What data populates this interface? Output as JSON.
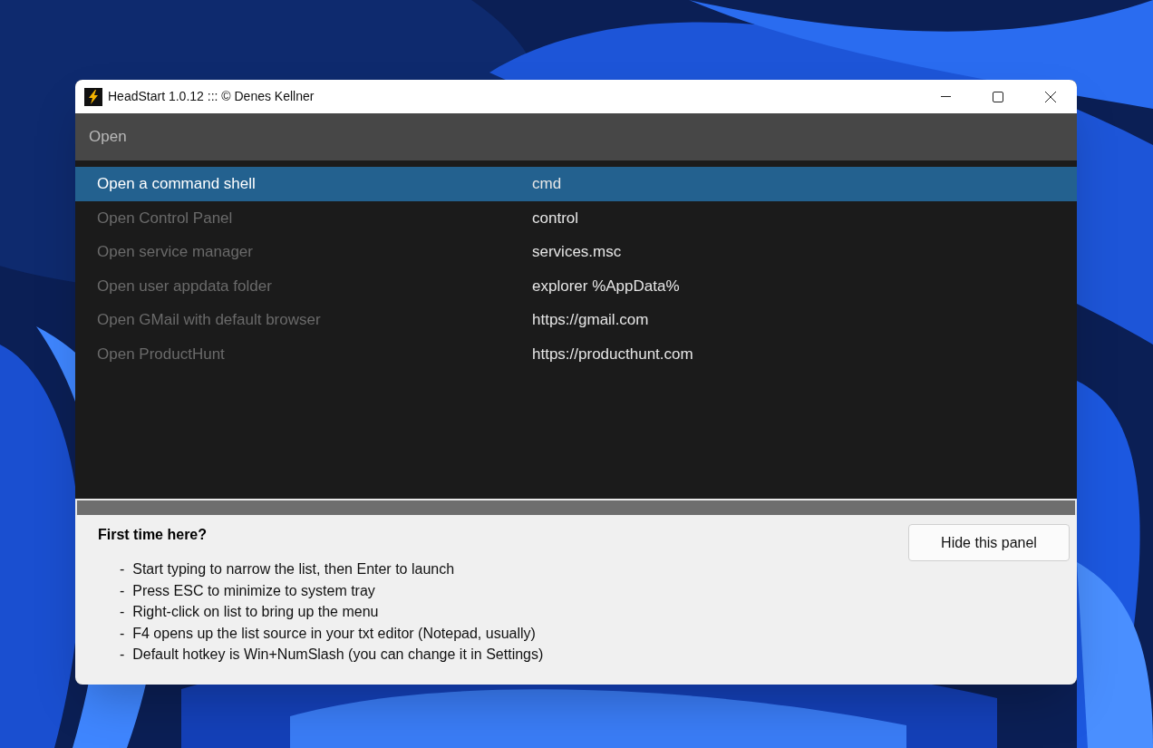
{
  "window": {
    "title": "HeadStart 1.0.12 ::: © Denes Kellner"
  },
  "search": {
    "value": "Open"
  },
  "list": {
    "rows": [
      {
        "label": "Open a command shell",
        "command": "cmd",
        "selected": true
      },
      {
        "label": "Open Control Panel",
        "command": "control",
        "selected": false
      },
      {
        "label": "Open service manager",
        "command": "services.msc",
        "selected": false
      },
      {
        "label": "Open user appdata folder",
        "command": "explorer %AppData%",
        "selected": false
      },
      {
        "label": "Open GMail with default browser",
        "command": "https://gmail.com",
        "selected": false
      },
      {
        "label": "Open ProductHunt",
        "command": "https://producthunt.com",
        "selected": false
      }
    ]
  },
  "help_panel": {
    "heading": "First time here?",
    "tips": [
      "-  Start typing to narrow the list, then Enter to launch",
      "-  Press ESC to minimize to system tray",
      "-  Right-click on list to bring up the menu",
      "-  F4 opens up the list source in your txt editor (Notepad, usually)",
      "-  Default hotkey is Win+NumSlash (you can change it in Settings)"
    ],
    "button": "Hide this panel"
  }
}
